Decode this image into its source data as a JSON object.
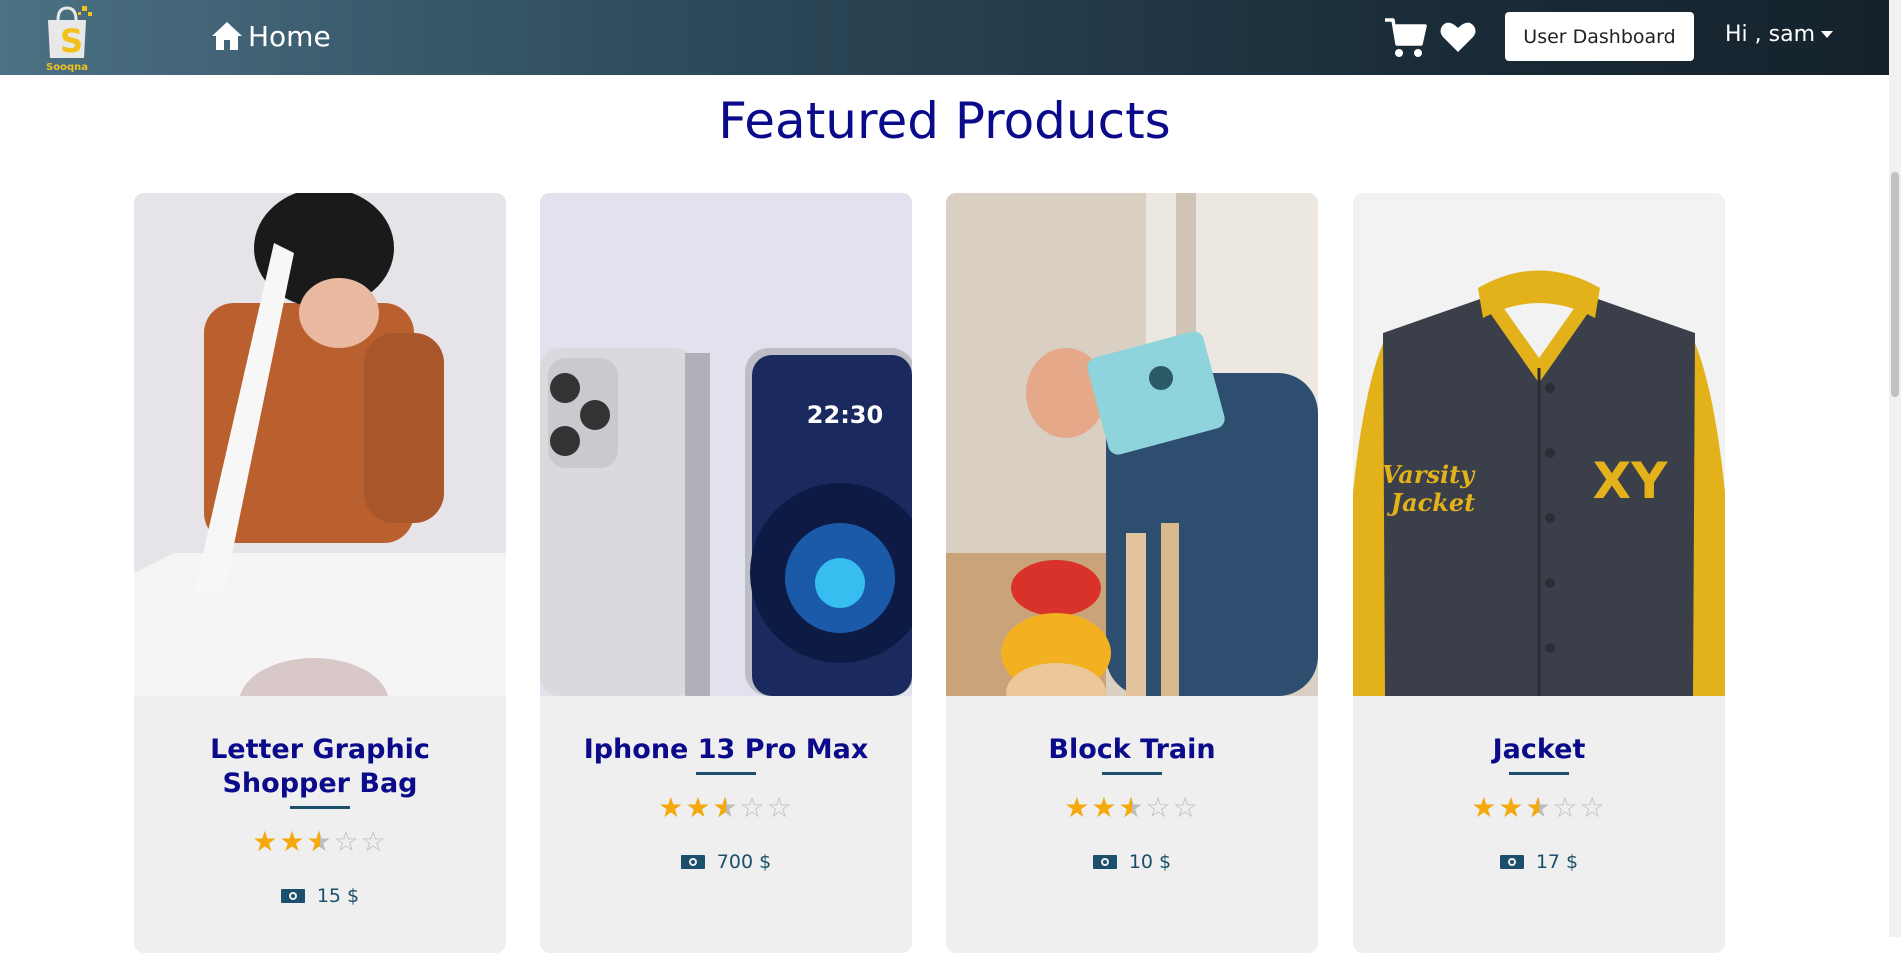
{
  "navbar": {
    "logo_text": "Sooqna",
    "home_label": "Home",
    "dashboard_button": "User Dashboard",
    "user_greeting": "Hi , sam",
    "icons": [
      "cart-icon",
      "heart-icon",
      "home-icon",
      "chevron-down-icon"
    ]
  },
  "section_title": "Featured Products",
  "products": [
    {
      "title": "Letter Graphic Shopper Bag",
      "rating": 2.5,
      "max_rating": 5,
      "price": "15 $"
    },
    {
      "title": "Iphone 13 Pro Max",
      "rating": 2.5,
      "max_rating": 5,
      "price": "700 $"
    },
    {
      "title": "Block Train",
      "rating": 2.5,
      "max_rating": 5,
      "price": "10 $"
    },
    {
      "title": "Jacket",
      "rating": 2.5,
      "max_rating": 5,
      "price": "17 $"
    }
  ],
  "colors": {
    "title_color": "#0a0a8a",
    "star_color": "#f4a90c",
    "accent": "#1b4f6b",
    "navbar_start": "#4b7183",
    "navbar_end": "#15222c"
  }
}
